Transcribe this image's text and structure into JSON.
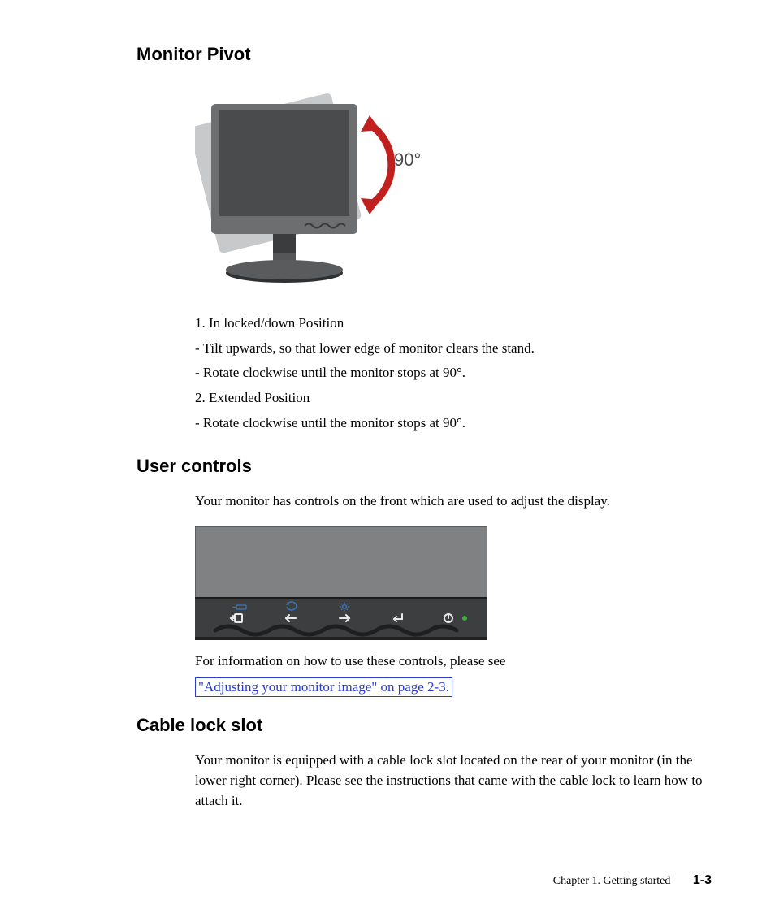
{
  "sections": {
    "pivot": {
      "heading": "Monitor Pivot",
      "angle_label": "90°",
      "lines": {
        "l1": "1. In locked/down Position",
        "l2": "- Tilt upwards, so that lower edge of monitor clears the stand.",
        "l3": "- Rotate clockwise until the monitor stops at 90°.",
        "l4": "2. Extended Position",
        "l5": "- Rotate clockwise until the monitor stops at 90°."
      }
    },
    "user_controls": {
      "heading": "User controls",
      "intro": "Your monitor has controls on the front which are used to adjust the display.",
      "followup": "For information on how to use these controls, please see",
      "link": "\"Adjusting your monitor image\" on page 2-3."
    },
    "cable_lock": {
      "heading": "Cable lock slot",
      "body": "Your monitor is equipped with a cable lock slot located on the rear of your monitor (in the lower right corner). Please see the instructions that came with the cable lock to learn how to attach it."
    }
  },
  "footer": {
    "chapter": "Chapter 1. Getting started",
    "page": "1-3"
  },
  "icons": {
    "pivot_arrow": "rotate-90-arrow",
    "bezel_buttons": [
      "exit-icon",
      "left-arrow-icon",
      "right-arrow-icon",
      "enter-icon",
      "power-icon"
    ],
    "bezel_top_icons": [
      "input-icon",
      "auto-adjust-icon",
      "brightness-icon"
    ],
    "power_led_color": "#3fae3f"
  }
}
